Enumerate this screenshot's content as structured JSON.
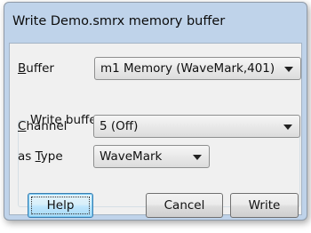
{
  "window": {
    "title": "Write Demo.smrx memory buffer"
  },
  "buffer": {
    "label_accel": "B",
    "label_rest": "uffer",
    "value": "m1 Memory (WaveMark,401)"
  },
  "group": {
    "title": "Write buffer to"
  },
  "channel": {
    "label_accel": "C",
    "label_rest": "hannel",
    "value": "5 (Off)"
  },
  "type": {
    "label_prefix": "as ",
    "label_accel": "T",
    "label_rest": "ype",
    "value": "WaveMark"
  },
  "buttons": {
    "help": "Help",
    "cancel": "Cancel",
    "write": "Write"
  },
  "icons": {
    "dropdown": "chevron-down-icon"
  },
  "colors": {
    "title_bar": "#bfd3ea",
    "client_bg": "#f0f0f0",
    "focus_button": "#bee6fd"
  }
}
